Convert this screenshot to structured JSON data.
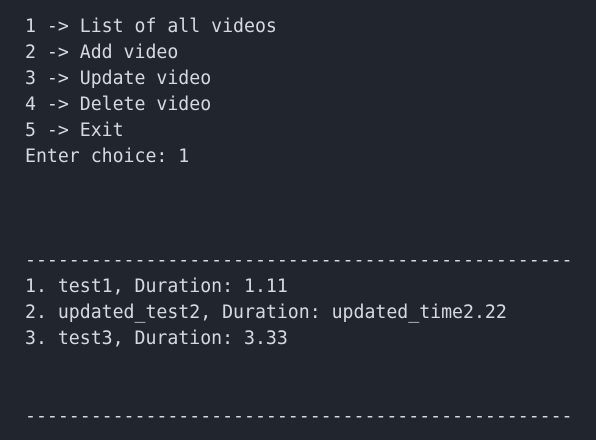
{
  "menu": {
    "options": [
      "1 -> List of all videos",
      "2 -> Add video",
      "3 -> Update video",
      "4 -> Delete video",
      "5 -> Exit"
    ],
    "prompt": "Enter choice: 1"
  },
  "divider": "--------------------------------------------------",
  "videos": [
    "1. test1, Duration: 1.11",
    "2. updated_test2, Duration: updated_time2.22",
    "3. test3, Duration: 3.33"
  ],
  "colors": {
    "background": "#21252e",
    "text": "#d6d9de"
  }
}
